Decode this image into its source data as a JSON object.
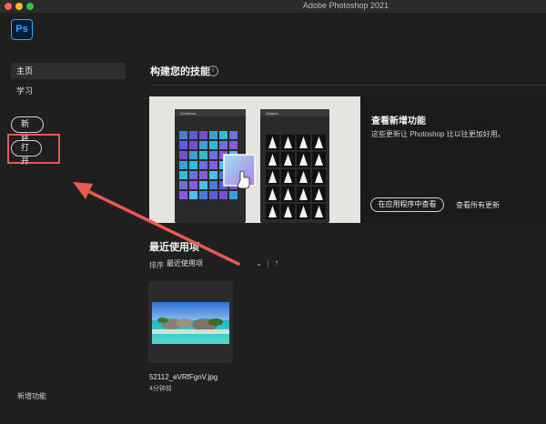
{
  "window": {
    "title": "Adobe Photoshop 2021"
  },
  "app": {
    "logo_text": "Ps"
  },
  "sidebar": {
    "items": [
      {
        "label": "主页"
      },
      {
        "label": "学习"
      }
    ],
    "new_button": "新建",
    "open_button": "打开",
    "whats_new_link": "新增功能"
  },
  "skills": {
    "title": "构建您的技能",
    "info_icon": "i"
  },
  "feature_card": {
    "heading": "查看新增功能",
    "description": "这些更新让 Photoshop 比以往更加好用。",
    "view_in_app": "在应用程序中查看",
    "view_all": "查看所有更新",
    "panel_left_title": "Gradients",
    "panel_right_title": "Shapes"
  },
  "recent": {
    "title": "最近使用项",
    "sort_label": "排序",
    "sort_value": "最近使用项",
    "sort_chevron": "⌄",
    "sort_direction": "↑",
    "files": [
      {
        "name": "52112_eVRfFgnV.jpg",
        "time": "4分钟前"
      }
    ]
  },
  "colors": {
    "accent": "#31a8ff",
    "highlight": "#e85a4f"
  },
  "icons": {
    "info": "info-icon",
    "chevron": "chevron-down-icon",
    "sort_direction": "sort-ascending-icon",
    "annotation_arrow": "arrow-icon"
  }
}
